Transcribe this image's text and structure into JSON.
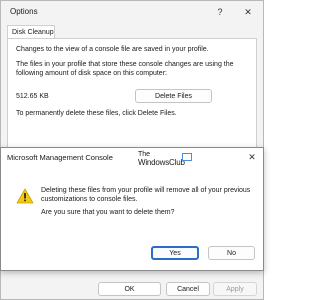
{
  "window": {
    "title": "Options",
    "help_glyph": "?",
    "close_glyph": "✕"
  },
  "tab": {
    "label": "Disk Cleanup"
  },
  "panel": {
    "intro": "Changes to the view of a console file are saved in your profile.",
    "files_text": "The files in your profile that store these console changes are using the following amount of disk space on this computer:",
    "size_value": "512.65 KB",
    "delete_label": "Delete Files",
    "instruction": "To permanently delete these files, click Delete Files."
  },
  "buttons": {
    "ok": "OK",
    "cancel": "Cancel",
    "apply": "Apply"
  },
  "dialog": {
    "title": "Microsoft Management Console",
    "close_glyph": "✕",
    "message": "Deleting these files from your profile will remove all of your previous customizations to console files.",
    "question": "Are you sure that you want to delete them?",
    "yes": "Yes",
    "no": "No"
  },
  "watermark": {
    "line1": "The",
    "line2": "WindowsClub"
  },
  "colors": {
    "accent": "#2b6cc4",
    "warning": "#f2c811",
    "background": "#f3f3f3"
  }
}
